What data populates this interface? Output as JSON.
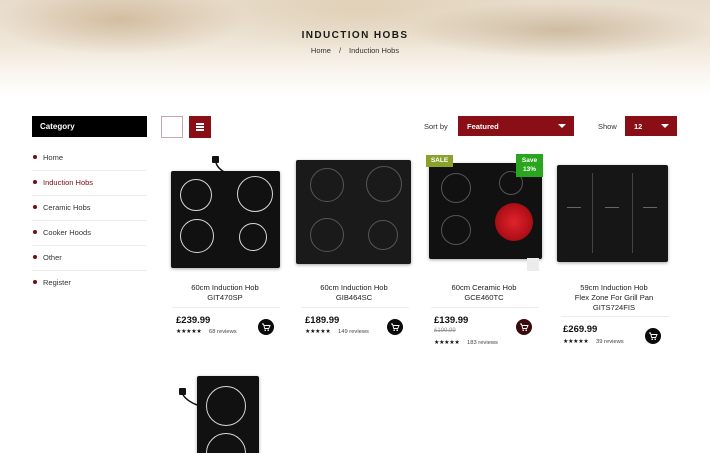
{
  "page": {
    "title": "INDUCTION HOBS"
  },
  "breadcrumb": {
    "home": "Home",
    "separator": "/",
    "current": "Induction Hobs"
  },
  "sidebar": {
    "heading": "Category",
    "items": [
      {
        "label": "Home",
        "active": false
      },
      {
        "label": "Induction Hobs",
        "active": true
      },
      {
        "label": "Ceramic Hobs",
        "active": false
      },
      {
        "label": "Cooker Hoods",
        "active": false
      },
      {
        "label": "Other",
        "active": false
      },
      {
        "label": "Register",
        "active": false
      }
    ]
  },
  "toolbar": {
    "sort_label": "Sort by",
    "sort_value": "Featured",
    "show_label": "Show",
    "show_value": "12"
  },
  "products": [
    {
      "name_line1": "60cm Induction Hob",
      "name_line2": "GIT470SP",
      "price": "£239.99",
      "stars": "★★★★★",
      "reviews": "68 reviews"
    },
    {
      "name_line1": "60cm Induction Hob",
      "name_line2": "GIB464SC",
      "price": "£189.99",
      "stars": "★★★★★",
      "reviews": "149 reviews"
    },
    {
      "name_line1": "60cm Ceramic Hob",
      "name_line2": "GCE460TC",
      "price": "£139.99",
      "was_price": "£199.99",
      "stars": "★★★★★",
      "reviews": "183 reviews",
      "sale_badge": "SALE",
      "save_badge_line1": "Save",
      "save_badge_line2": "13%"
    },
    {
      "name_line1": "59cm Induction Hob",
      "name_line2": "Flex Zone For Grill Pan",
      "name_line3": "GITS724FIS",
      "price": "£269.99",
      "stars": "★★★★★",
      "reviews": "39 reviews"
    }
  ],
  "colors": {
    "accent": "#8a0e16",
    "sale": "#8aa22c",
    "save": "#2aa51e"
  },
  "icons": [
    "grid-view-icon",
    "list-view-icon",
    "chevron-down-icon",
    "cart-icon",
    "star-icon",
    "plug-cable-icon"
  ]
}
